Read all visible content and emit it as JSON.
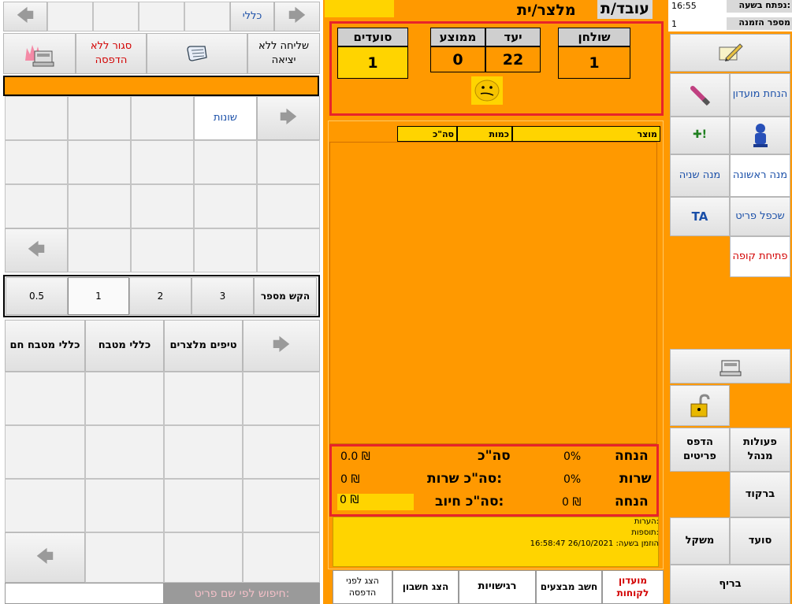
{
  "left": {
    "top_bar": {
      "category_label": "כללי"
    },
    "actions": {
      "send_no_exit": "שליחה ללא יציאה",
      "close_no_print": "סגור ללא הדפסה"
    },
    "tab_misc": "שונות",
    "qty": {
      "label": "הקש מספר",
      "options": [
        "3",
        "2",
        "1",
        "0.5"
      ]
    },
    "kitchen": [
      "טיפים מלצרים",
      "כללי מטבח",
      "כללי מטבח חם"
    ],
    "search_placeholder": "חיפוש לפי שם פריט:"
  },
  "center": {
    "waiter_title": "עובד/ת",
    "waiter_title2": "מלצר/ית",
    "stats": {
      "table_label": "שולחן",
      "table_value": "1",
      "goal_label": "יעד",
      "goal_value": "22",
      "avg_label": "ממוצע",
      "avg_value": "0",
      "diners_label": "סועדים",
      "diners_value": "1"
    },
    "order_headers": {
      "product": "מוצר",
      "qty": "כמות",
      "total": "סה\"כ"
    },
    "totals": {
      "discount_label": "הנחה",
      "discount_pct": "0%",
      "total_label": "סה\"כ",
      "total_value": "0.0 ₪",
      "service_label": "שרות",
      "service_pct": "0%",
      "service_total_label": "סה\"כ שרות:",
      "service_total_value": "0 ₪",
      "discount2_label": "הנחה",
      "discount2_value": "0 ₪",
      "charge_label": "סה\"כ חיוב:",
      "charge_value": "0 ₪"
    },
    "notes": {
      "notes_label": "הערות:",
      "additions_label": "תוספות:",
      "ordered_at": "הוזמן בשעה: 26/10/2021 16:58:47"
    },
    "footer": {
      "club_customers": "מועדון לקוחות",
      "calc_promos": "חשב מבצעים",
      "sensitivities": "רגישויות",
      "show_bill": "הצג חשבון",
      "show_before_print": "הצג לפני הדפסה"
    }
  },
  "right": {
    "opened_at_label": "נפתח בשעה:",
    "opened_at_value": "16:55",
    "order_no_label": "מספר הזמנה",
    "order_no_value": "1",
    "club_discount": "הנחת מועדון",
    "first_course": "מנה ראשונה",
    "second_course": "מנה שניה",
    "duplicate_item": "שכפל פריט",
    "ta": "TA",
    "open_drawer": "פתיחת קופה",
    "manager_actions": "פעולות מנהל",
    "print_items": "הדפס פריטים",
    "barcode": "ברקוד",
    "diner": "סועד",
    "weight": "משקל",
    "brief": "בריף"
  },
  "colors": {
    "accent": "#ff9900",
    "highlight": "#ffd400",
    "frame": "#e8242a"
  }
}
